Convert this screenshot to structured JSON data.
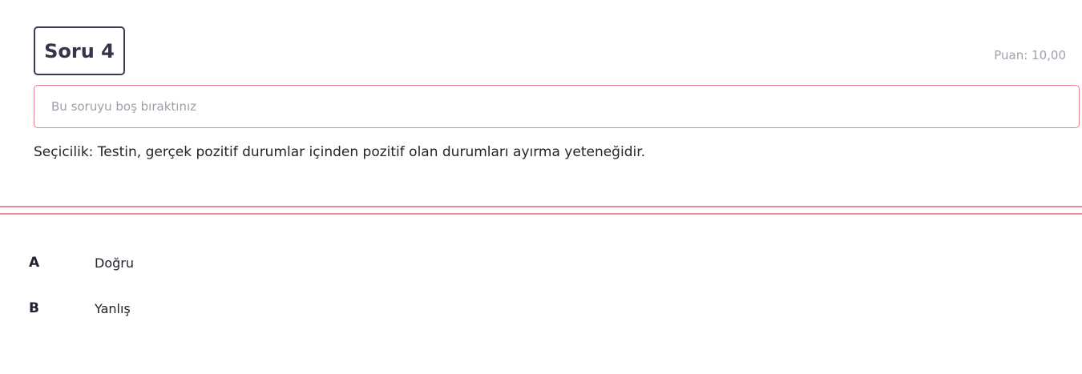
{
  "question": {
    "title": "Soru 4",
    "points": "Puan: 10,00",
    "notice": "Bu soruyu boş bıraktınız",
    "text": "Seçicilik: Testin, gerçek pozitif durumlar içinden pozitif olan durumları ayırma yeteneğidir."
  },
  "options": [
    {
      "letter": "A",
      "label": "Doğru"
    },
    {
      "letter": "B",
      "label": "Yanlış"
    }
  ],
  "colors": {
    "accent_border": "#e77d8e",
    "divider": "#e98ba0",
    "title_border": "#3a3d4f",
    "muted_text": "#9da0a9"
  }
}
